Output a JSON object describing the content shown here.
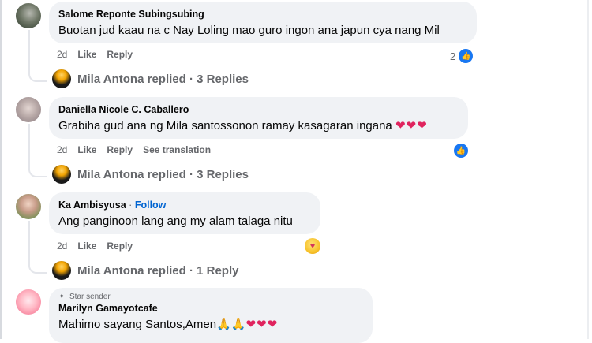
{
  "comments": [
    {
      "author": "Salome Reponte Subingsubing",
      "text": "Buotan jud kaau na c Nay Loling mao guro ingon ana japun cya nang Mil",
      "time": "2d",
      "like": "Like",
      "reply": "Reply",
      "reaction_count": "2",
      "replies_label": "Mila Antona replied · 3 Replies"
    },
    {
      "author": "Daniella Nicole C. Caballero",
      "text": "Grabiha gud ana ng Mila santossonon ramay kasagaran ingana",
      "emoji": "❤❤❤",
      "time": "2d",
      "like": "Like",
      "reply": "Reply",
      "see_translation": "See translation",
      "replies_label": "Mila Antona replied · 3 Replies"
    },
    {
      "author": "Ka Ambisyusa",
      "separator": "·",
      "follow": "Follow",
      "text": "Ang panginoon lang ang my alam talaga nitu",
      "time": "2d",
      "like": "Like",
      "reply": "Reply",
      "replies_label": "Mila Antona replied · 1 Reply"
    },
    {
      "badge": "Star sender",
      "author": "Marilyn Gamayotcafe",
      "text": "Mahimo sayang Santos,Amen",
      "emoji_pray": "🙏🙏",
      "emoji_hearts": "❤❤❤"
    }
  ],
  "colors": {
    "bubble": "#f0f2f5",
    "link": "#0064d1",
    "meta": "#65676b",
    "like_blue": "#1877f2"
  },
  "icons": [
    "like-icon",
    "care-icon",
    "star-icon",
    "heart-icon",
    "pray-icon"
  ]
}
